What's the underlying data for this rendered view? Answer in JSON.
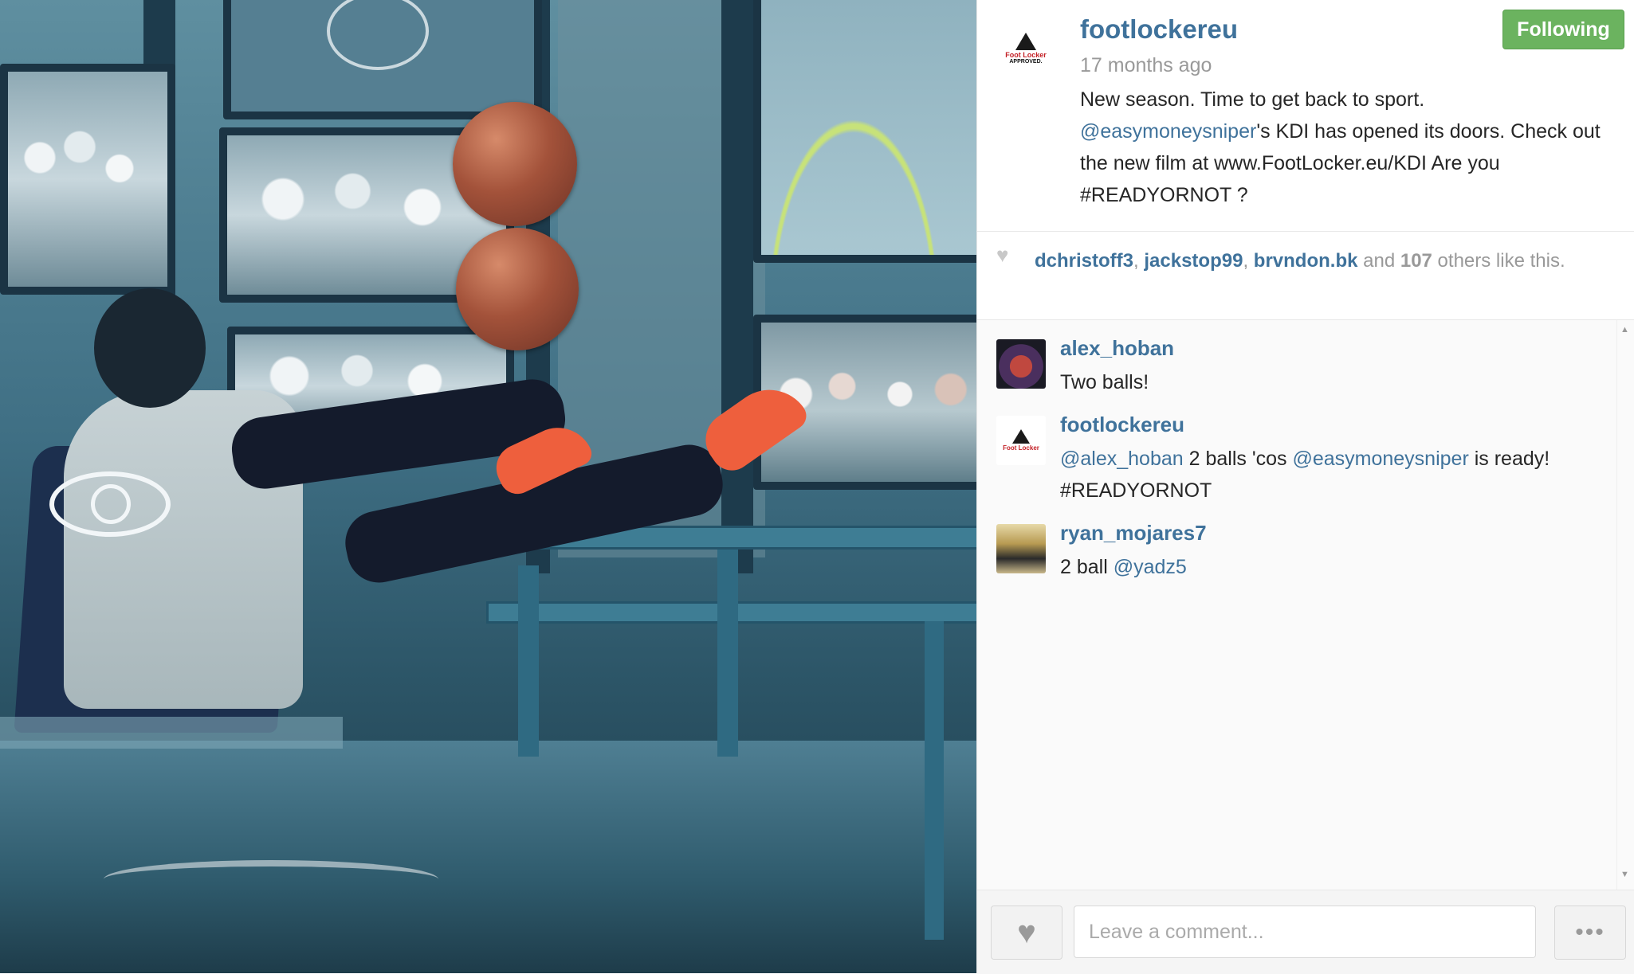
{
  "post": {
    "username": "footlockereu",
    "time_ago": "17 months ago",
    "follow_label": "Following",
    "caption_line1": "New season. Time to get back to sport.",
    "caption_mention": "@easymoneysniper",
    "caption_line2_rest": "'s KDI has opened its doors. Check out the new film at www.FootLocker.eu/KDI Are you #READYORNOT ?",
    "avatar_brand": "Foot Locker",
    "avatar_sub": "APPROVED."
  },
  "likes": {
    "users": [
      "dchristoff3",
      "jackstop99",
      "brvndon.bk"
    ],
    "sep1": ", ",
    "sep2": ", ",
    "and_text": " and ",
    "count": "107",
    "others_text": " others like this."
  },
  "comments": [
    {
      "username": "alex_hoban",
      "text": "Two balls!"
    },
    {
      "username": "footlockereu",
      "mention1": "@alex_hoban",
      "text_mid": " 2 balls 'cos ",
      "mention2": "@easymoneysniper",
      "text_end": " is ready! #READYORNOT"
    },
    {
      "username": "ryan_mojares7",
      "text": "2 ball ",
      "mention": "@yadz5"
    }
  ],
  "footer": {
    "comment_placeholder": "Leave a comment...",
    "like_icon": "heart-icon",
    "more_icon": "ellipsis-icon"
  },
  "colors": {
    "link": "#3f729b",
    "follow_green": "#6bb35f",
    "text": "#262626",
    "muted": "#999999"
  }
}
